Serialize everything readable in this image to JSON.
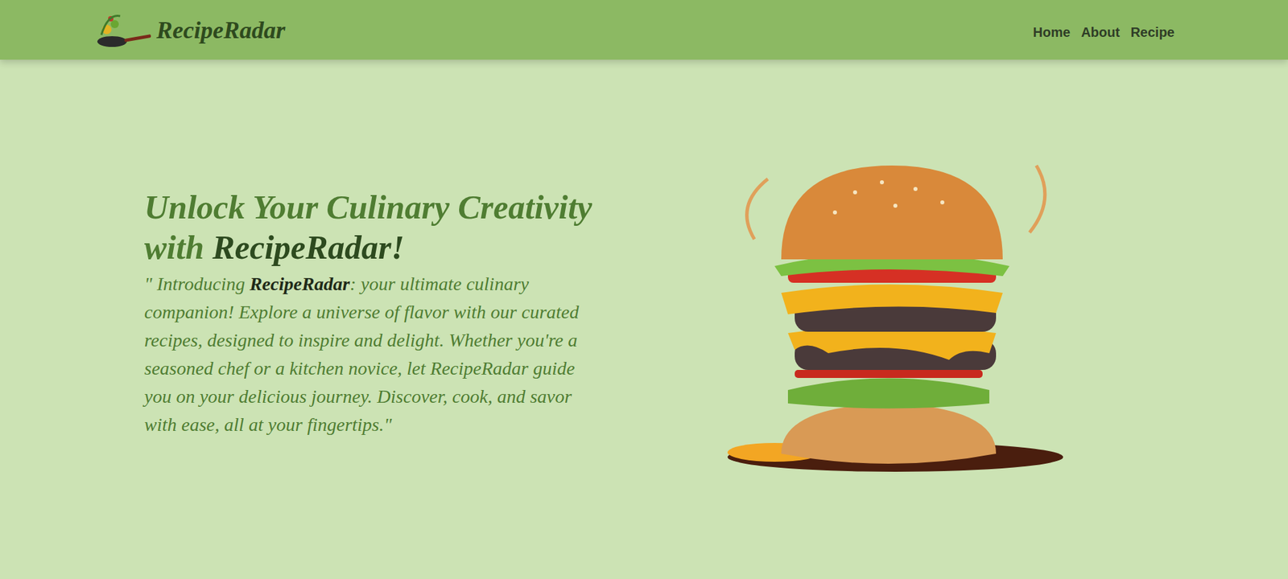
{
  "header": {
    "logo_text": "RecipeRadar",
    "nav": [
      {
        "label": "Home"
      },
      {
        "label": "About"
      },
      {
        "label": "Recipe"
      }
    ]
  },
  "hero": {
    "heading_lead": "Unlock Your Culinary Creativity with ",
    "heading_brand": "RecipeRadar!",
    "intro_open": "\" Introducing ",
    "intro_brand": "RecipeRadar",
    "intro_rest": ": your ultimate culinary companion! Explore a universe of flavor with our curated recipes, designed to inspire and delight. Whether you're a seasoned chef or a kitchen novice, let RecipeRadar guide you on your delicious journey. Discover, cook, and savor with ease, all at your fingertips.\""
  }
}
